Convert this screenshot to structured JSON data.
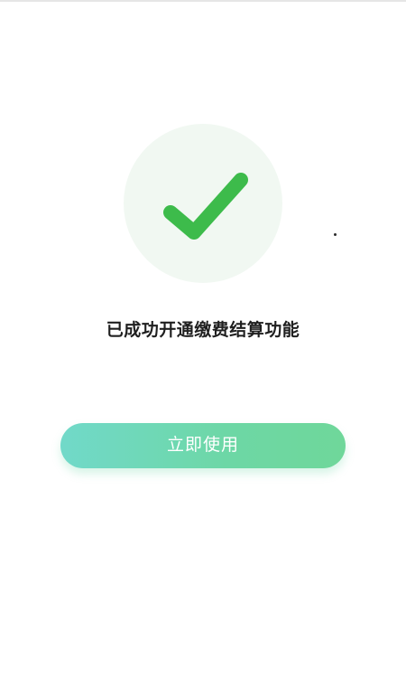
{
  "result": {
    "icon": "check-icon",
    "icon_color": "#3dbb4b",
    "circle_color": "#f1f8f2",
    "message": "已成功开通缴费结算功能"
  },
  "action": {
    "use_label": "立即使用",
    "gradient_start": "#71d9c9",
    "gradient_end": "#6fd79a"
  }
}
